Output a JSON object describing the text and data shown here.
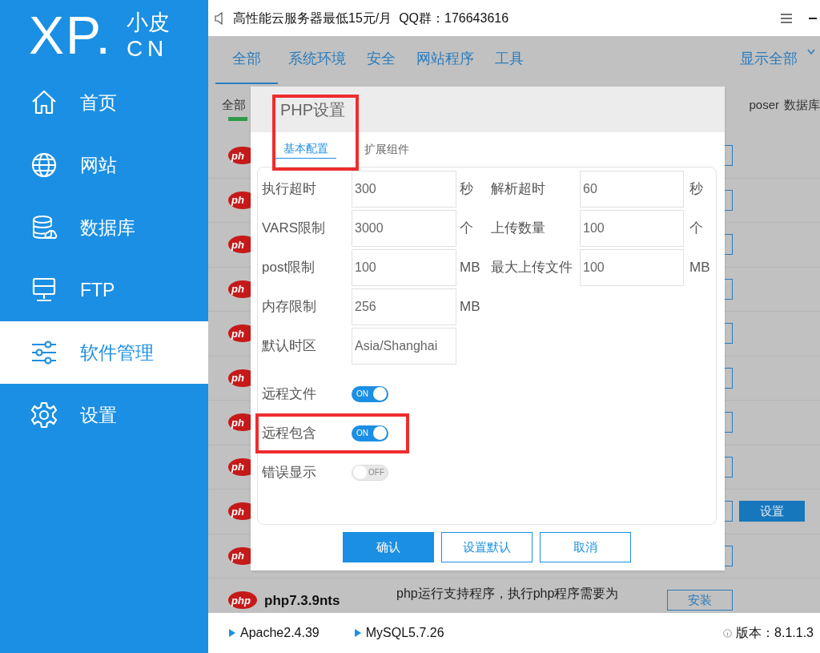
{
  "logo": {
    "mark": "XP.",
    "name": "小皮",
    "domain": "CN"
  },
  "sidebar": {
    "items": [
      {
        "label": "首页",
        "selected": false
      },
      {
        "label": "网站",
        "selected": false
      },
      {
        "label": "数据库",
        "selected": false
      },
      {
        "label": "FTP",
        "selected": false
      },
      {
        "label": "软件管理",
        "selected": true
      },
      {
        "label": "设置",
        "selected": false
      }
    ]
  },
  "top_bar": {
    "notice": "高性能云服务器最低15元/月  QQ群：176643616"
  },
  "tabs": [
    {
      "label": "全部",
      "selected": true
    },
    {
      "label": "系统环境",
      "selected": false
    },
    {
      "label": "安全",
      "selected": false
    },
    {
      "label": "网站程序",
      "selected": false
    },
    {
      "label": "工具",
      "selected": false
    }
  ],
  "show_all": "显示全部",
  "sub_tabs": [
    {
      "label": "全部",
      "selected": true
    },
    {
      "label": "poser",
      "selected": false
    },
    {
      "label": "数据库",
      "selected": false
    }
  ],
  "software": [
    {
      "badge": "ph",
      "buttons": [
        {
          "kind": "outline"
        }
      ]
    },
    {
      "badge": "ph",
      "buttons": [
        {
          "kind": "outline"
        }
      ]
    },
    {
      "badge": "ph",
      "buttons": [
        {
          "kind": "outline"
        }
      ]
    },
    {
      "badge": "ph",
      "buttons": [
        {
          "kind": "outline"
        }
      ]
    },
    {
      "badge": "ph",
      "buttons": [
        {
          "kind": "outline"
        }
      ]
    },
    {
      "badge": "ph",
      "buttons": [
        {
          "kind": "outline"
        }
      ]
    },
    {
      "badge": "ph",
      "buttons": [
        {
          "kind": "outline"
        }
      ]
    },
    {
      "badge": "ph",
      "buttons": [
        {
          "kind": "outline"
        }
      ]
    },
    {
      "badge": "ph",
      "buttons": [
        {
          "kind": "outline"
        },
        {
          "kind": "filled",
          "label": "设置"
        }
      ]
    },
    {
      "badge": "ph",
      "buttons": [
        {
          "kind": "outline"
        }
      ]
    },
    {
      "badge": "php",
      "name": "php7.3.9nts",
      "description": [
        "php运行支持程序，执行php程序需要为"
      ],
      "buttons": [
        {
          "kind": "outline",
          "label": "安装"
        }
      ]
    }
  ],
  "dialog": {
    "title": "PHP设置",
    "title_highlighted": true,
    "tabs": [
      {
        "label": "基本配置",
        "selected": true
      },
      {
        "label": "扩展组件",
        "selected": false
      }
    ],
    "fields": [
      [
        {
          "label": "执行超时",
          "value": "300",
          "unit": "秒"
        },
        {
          "label": "解析超时",
          "value": "60",
          "unit": "秒"
        }
      ],
      [
        {
          "label": "VARS限制",
          "value": "3000",
          "unit": "个"
        },
        {
          "label": "上传数量",
          "value": "100",
          "unit": "个"
        }
      ],
      [
        {
          "label": "post限制",
          "value": "100",
          "unit": "MB"
        },
        {
          "label": "最大上传文件",
          "value": "100",
          "unit": "MB"
        }
      ],
      [
        {
          "label": "内存限制",
          "value": "256",
          "unit": "MB"
        }
      ],
      [
        {
          "label": "默认时区",
          "value": "Asia/Shanghai"
        }
      ]
    ],
    "switches": [
      {
        "label": "远程文件",
        "on": true,
        "text": "ON",
        "highlighted": false
      },
      {
        "label": "远程包含",
        "on": true,
        "text": "ON",
        "highlighted": true
      },
      {
        "label": "错误显示",
        "on": false,
        "text": "OFF",
        "highlighted": false
      }
    ],
    "buttons": [
      {
        "label": "确认",
        "kind": "primary"
      },
      {
        "label": "设置默认",
        "kind": "outline"
      },
      {
        "label": "取消",
        "kind": "outline"
      }
    ]
  },
  "footer": {
    "services": [
      "Apache2.4.39",
      "MySQL5.7.26"
    ],
    "version": "版本：8.1.1.3"
  }
}
